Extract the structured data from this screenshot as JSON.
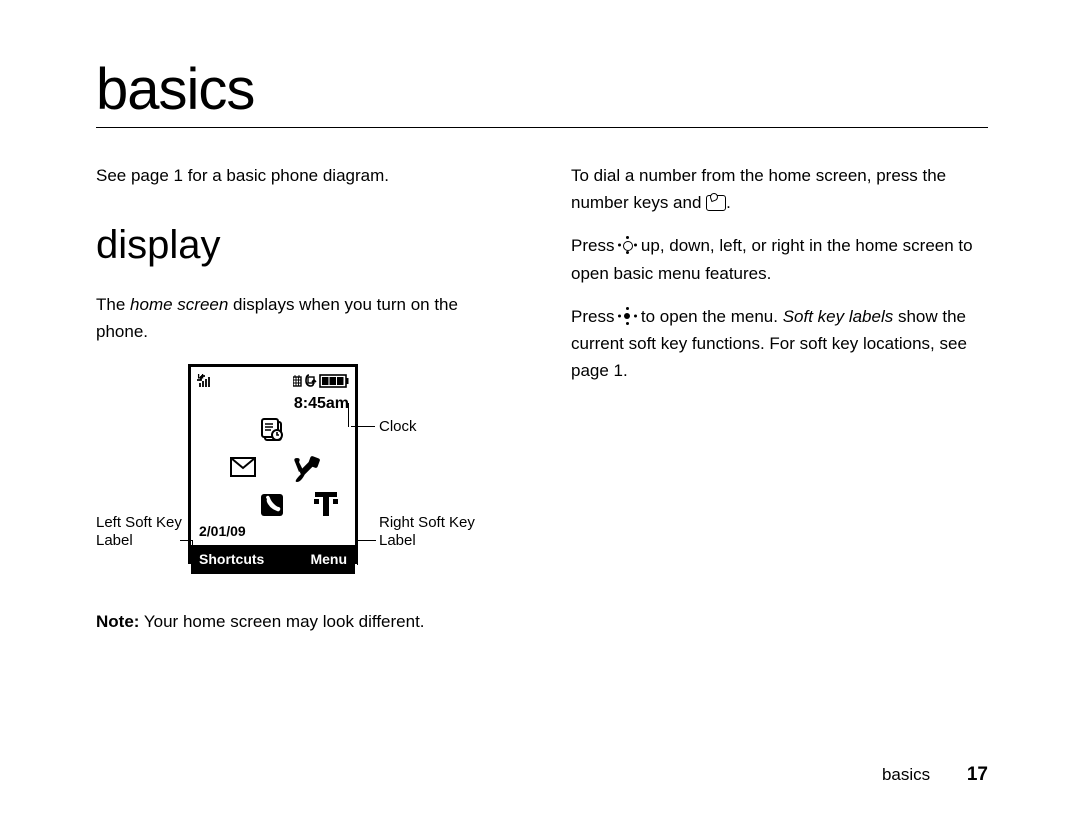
{
  "chapter_title": "basics",
  "left_column": {
    "p1": "See page 1 for a basic phone diagram.",
    "section_title": "display",
    "p2a": "The ",
    "p2b": "home screen",
    "p2c": " displays when you turn on the phone.",
    "note_label": "Note:",
    "note_text": " Your home screen may look different."
  },
  "right_column": {
    "p1": "To dial a number from the home screen, press the number keys and ",
    "p1_end": ".",
    "p2a": "Press ",
    "p2b": " up, down, left, or right in the home screen to open basic menu features.",
    "p3a": "Press ",
    "p3b": " to open the menu. ",
    "p3c": "Soft key labels",
    "p3d": " show the current soft key functions. For soft key locations, see page 1."
  },
  "phone": {
    "time": "8:45am",
    "date": "2/01/09",
    "softkey_left": "Shortcuts",
    "softkey_right": "Menu"
  },
  "callouts": {
    "clock": "Clock",
    "left1": "Left Soft Key",
    "left2": "Label",
    "right1": "Right Soft Key",
    "right2": "Label"
  },
  "footer": {
    "section": "basics",
    "page": "17"
  }
}
